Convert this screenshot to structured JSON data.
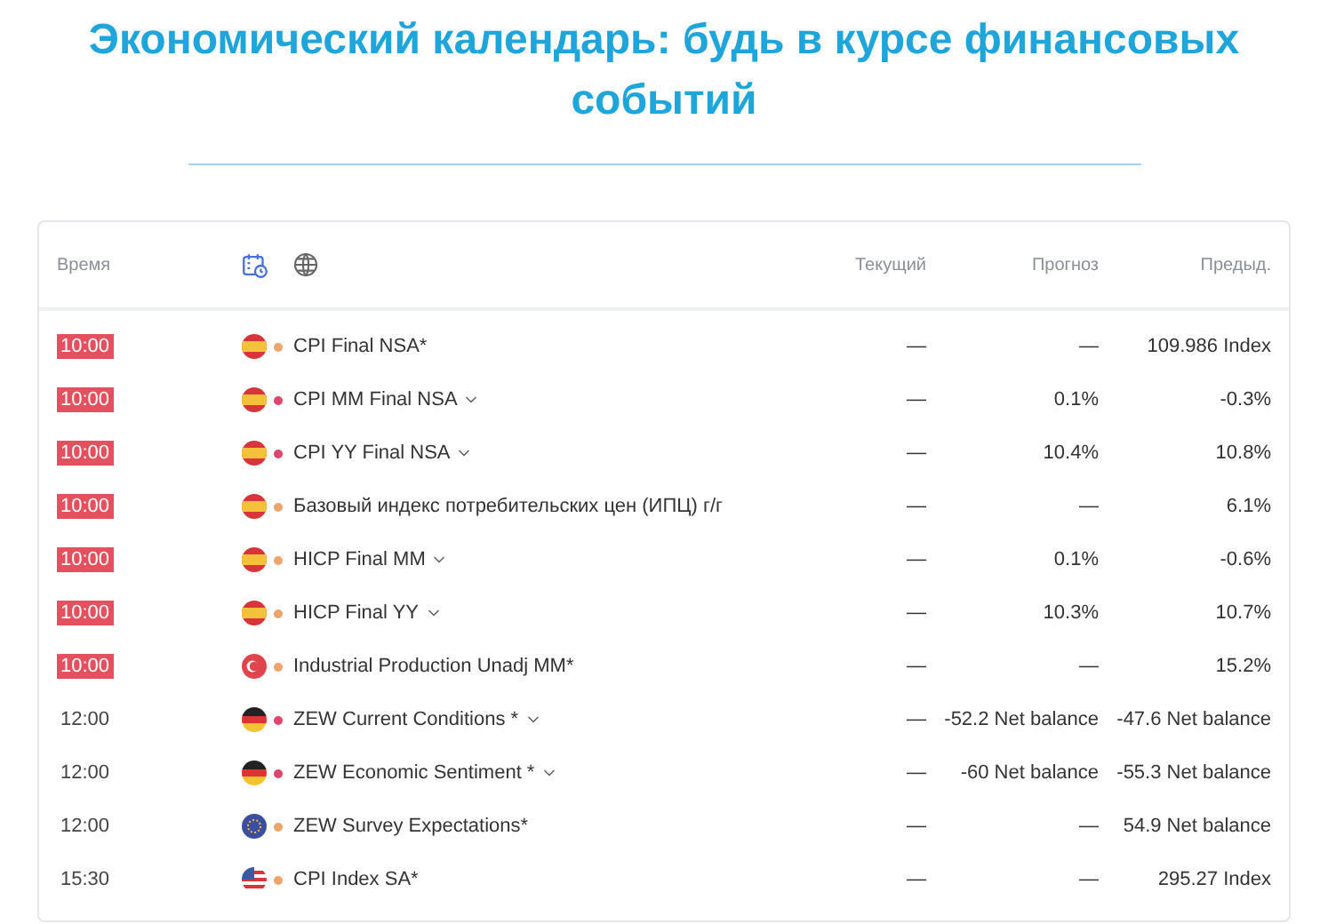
{
  "title": "Экономический календарь: будь в курсе финансовых событий",
  "table": {
    "columns": [
      "Время",
      "Текущий",
      "Прогноз",
      "Предыд."
    ],
    "rows": [
      {
        "time": "10:00",
        "highlighted": true,
        "kind": "es",
        "color": "#f0a36a",
        "event": "CPI Final NSA*",
        "expandable": false,
        "actual": "—",
        "forecast": "—",
        "previous": "109.986 Index"
      },
      {
        "time": "10:00",
        "highlighted": true,
        "kind": "es",
        "color": "#e0456b",
        "event": "CPI MM Final NSA",
        "expandable": true,
        "actual": "—",
        "forecast": "0.1%",
        "previous": "-0.3%"
      },
      {
        "time": "10:00",
        "highlighted": true,
        "kind": "es",
        "color": "#e0456b",
        "event": "CPI YY Final NSA",
        "expandable": true,
        "actual": "—",
        "forecast": "10.4%",
        "previous": "10.8%"
      },
      {
        "time": "10:00",
        "highlighted": true,
        "kind": "es",
        "color": "#f0a36a",
        "event": "Базовый индекс потребительских цен (ИПЦ) г/г",
        "expandable": false,
        "actual": "—",
        "forecast": "—",
        "previous": "6.1%"
      },
      {
        "time": "10:00",
        "highlighted": true,
        "kind": "es",
        "color": "#f0a36a",
        "event": "HICP Final MM",
        "expandable": true,
        "actual": "—",
        "forecast": "0.1%",
        "previous": "-0.6%"
      },
      {
        "time": "10:00",
        "highlighted": true,
        "kind": "es",
        "color": "#f0a36a",
        "event": "HICP Final YY",
        "expandable": true,
        "actual": "—",
        "forecast": "10.3%",
        "previous": "10.7%"
      },
      {
        "time": "10:00",
        "highlighted": true,
        "kind": "tr",
        "color": "#f0a36a",
        "event": "Industrial Production Unadj MM*",
        "expandable": false,
        "actual": "—",
        "forecast": "—",
        "previous": "15.2%"
      },
      {
        "time": "12:00",
        "highlighted": false,
        "kind": "de",
        "color": "#e0456b",
        "event": "ZEW Current Conditions *",
        "expandable": true,
        "actual": "—",
        "forecast": "-52.2 Net balance",
        "previous": "-47.6 Net balance"
      },
      {
        "time": "12:00",
        "highlighted": false,
        "kind": "de",
        "color": "#e0456b",
        "event": "ZEW Economic Sentiment *",
        "expandable": true,
        "actual": "—",
        "forecast": "-60 Net balance",
        "previous": "-55.3 Net balance"
      },
      {
        "time": "12:00",
        "highlighted": false,
        "kind": "eu",
        "color": "#f0a36a",
        "event": "ZEW Survey Expectations*",
        "expandable": false,
        "actual": "—",
        "forecast": "—",
        "previous": "54.9 Net balance"
      },
      {
        "time": "15:30",
        "highlighted": false,
        "kind": "us",
        "color": "#f0a36a",
        "event": "CPI Index SA*",
        "expandable": false,
        "actual": "—",
        "forecast": "—",
        "previous": "295.27 Index"
      }
    ]
  }
}
